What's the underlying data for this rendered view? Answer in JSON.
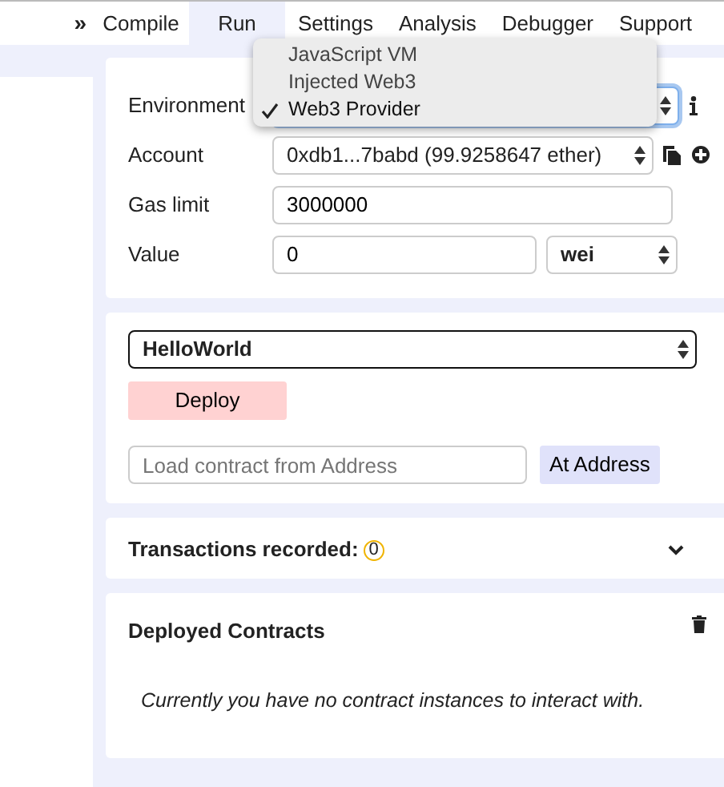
{
  "tabs_toggle": "»",
  "tabs": [
    {
      "label": "Compile",
      "selected": false
    },
    {
      "label": "Run",
      "selected": true
    },
    {
      "label": "Settings",
      "selected": false
    },
    {
      "label": "Analysis",
      "selected": false
    },
    {
      "label": "Debugger",
      "selected": false
    },
    {
      "label": "Support",
      "selected": false
    }
  ],
  "environment_menu": {
    "options": [
      {
        "label": "JavaScript VM",
        "selected": false
      },
      {
        "label": "Injected Web3",
        "selected": false
      },
      {
        "label": "Web3 Provider",
        "selected": true
      }
    ]
  },
  "settings": {
    "environment_label": "Environment",
    "account_label": "Account",
    "account_value": "0xdb1...7babd (99.9258647 ether)",
    "gas_limit_label": "Gas limit",
    "gas_limit_value": "3000000",
    "value_label": "Value",
    "value_value": "0",
    "value_unit": "wei"
  },
  "contract": {
    "selected": "HelloWorld",
    "deploy_button": "Deploy",
    "address_placeholder": "Load contract from Address",
    "at_address_button": "At Address"
  },
  "transactions": {
    "title": "Transactions recorded:",
    "count": "0"
  },
  "deployed": {
    "title": "Deployed Contracts",
    "empty_message": "Currently you have no contract instances to interact with."
  }
}
